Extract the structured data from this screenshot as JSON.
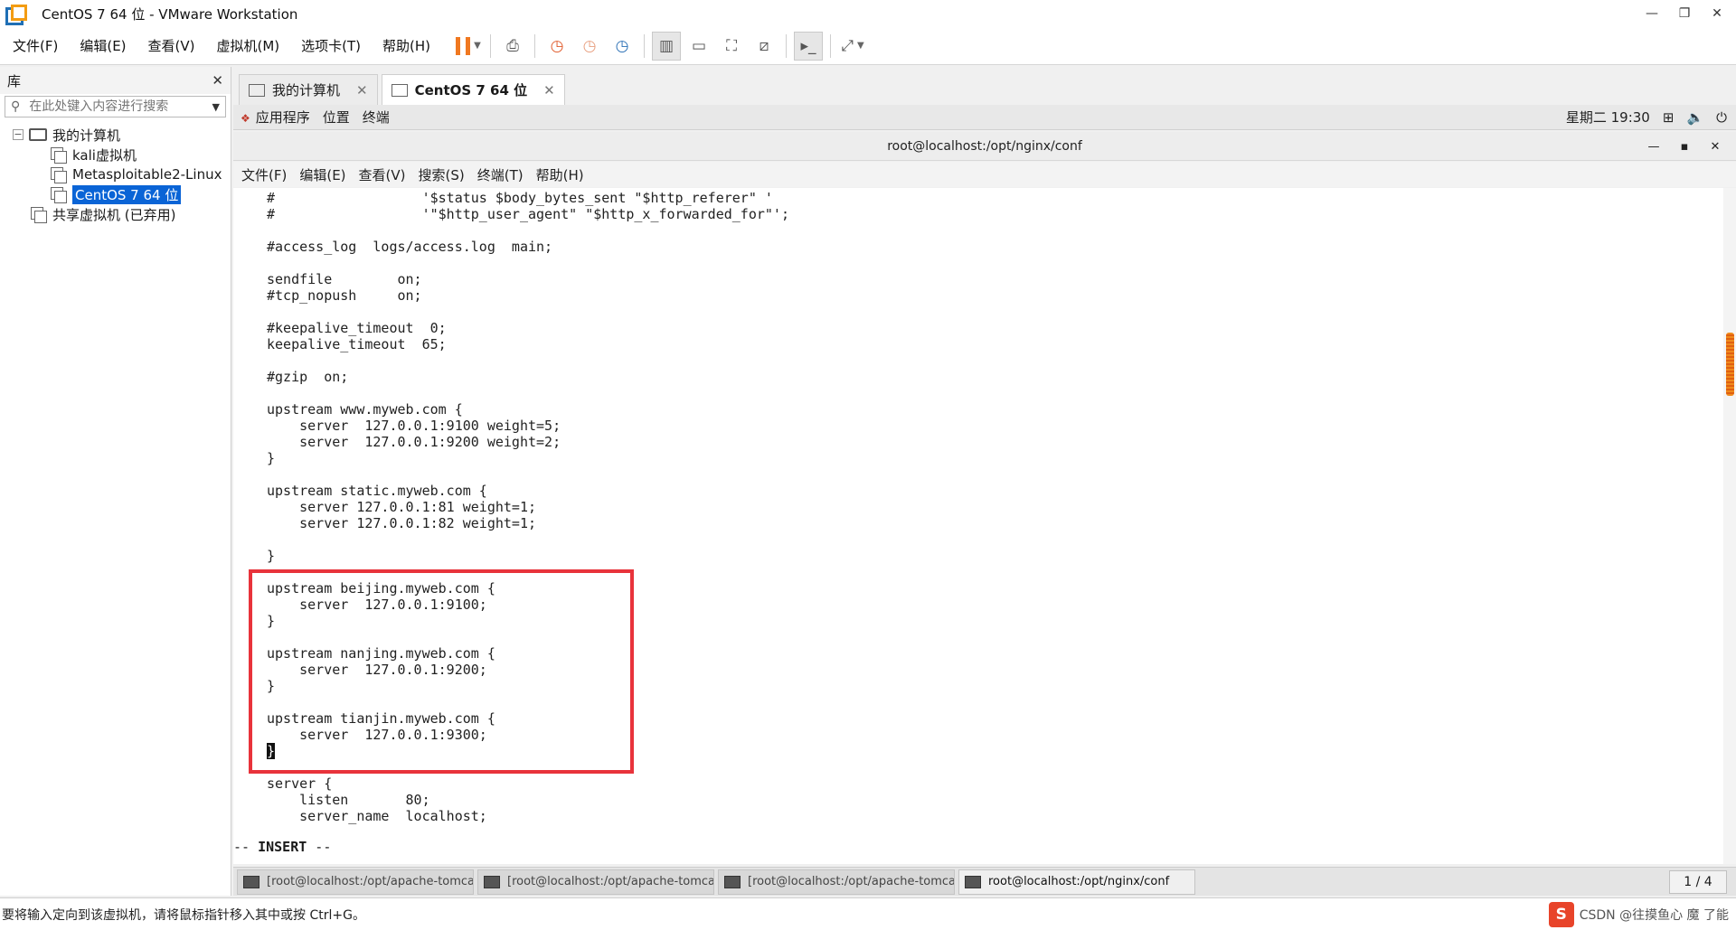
{
  "window": {
    "title": "CentOS 7 64 位 - VMware Workstation"
  },
  "menu": [
    "文件(F)",
    "编辑(E)",
    "查看(V)",
    "虚拟机(M)",
    "选项卡(T)",
    "帮助(H)"
  ],
  "library": {
    "title": "库",
    "search_placeholder": "在此处键入内容进行搜索",
    "root": "我的计算机",
    "items": [
      "kali虚拟机",
      "Metasploitable2-Linux",
      "CentOS 7 64 位"
    ],
    "shared": "共享虚拟机 (已弃用)"
  },
  "tabs": [
    {
      "label": "我的计算机"
    },
    {
      "label": "CentOS 7 64 位"
    }
  ],
  "gnome": {
    "apps": "应用程序",
    "places": "位置",
    "terminal": "终端",
    "clock": "星期二 19:30"
  },
  "terminal": {
    "title": "root@localhost:/opt/nginx/conf",
    "menu": [
      "文件(F)",
      "编辑(E)",
      "查看(V)",
      "搜索(S)",
      "终端(T)",
      "帮助(H)"
    ],
    "lines": [
      "#                  '$status $body_bytes_sent \"$http_referer\" '",
      "#                  '\"$http_user_agent\" \"$http_x_forwarded_for\"';",
      "",
      "#access_log  logs/access.log  main;",
      "",
      "sendfile        on;",
      "#tcp_nopush     on;",
      "",
      "#keepalive_timeout  0;",
      "keepalive_timeout  65;",
      "",
      "#gzip  on;",
      "",
      "upstream www.myweb.com {",
      "    server  127.0.0.1:9100 weight=5;",
      "    server  127.0.0.1:9200 weight=2;",
      "}",
      "",
      "upstream static.myweb.com {",
      "    server 127.0.0.1:81 weight=1;",
      "    server 127.0.0.1:82 weight=1;",
      "",
      "}",
      "",
      "upstream beijing.myweb.com {",
      "    server  127.0.0.1:9100;",
      "}",
      "",
      "upstream nanjing.myweb.com {",
      "    server  127.0.0.1:9200;",
      "}",
      "",
      "upstream tianjin.myweb.com {",
      "    server  127.0.0.1:9300;",
      "}",
      "",
      "server {",
      "    listen       80;",
      "    server_name  localhost;"
    ],
    "mode_prefix": "-- ",
    "mode": "INSERT",
    "mode_suffix": " --"
  },
  "taskbar": {
    "items": [
      "[root@localhost:/opt/apache-tomca…",
      "[root@localhost:/opt/apache-tomca…",
      "[root@localhost:/opt/apache-tomca…",
      "root@localhost:/opt/nginx/conf"
    ],
    "page": "1 / 4"
  },
  "statusbar": {
    "message": "要将输入定向到该虚拟机，请将鼠标指针移入其中或按 Ctrl+G。",
    "watermark": "CSDN @往摸鱼心 魔 了能"
  },
  "colors": {
    "highlight": "#e8333b",
    "selection": "#0a64d6",
    "pause": "#f07820"
  }
}
